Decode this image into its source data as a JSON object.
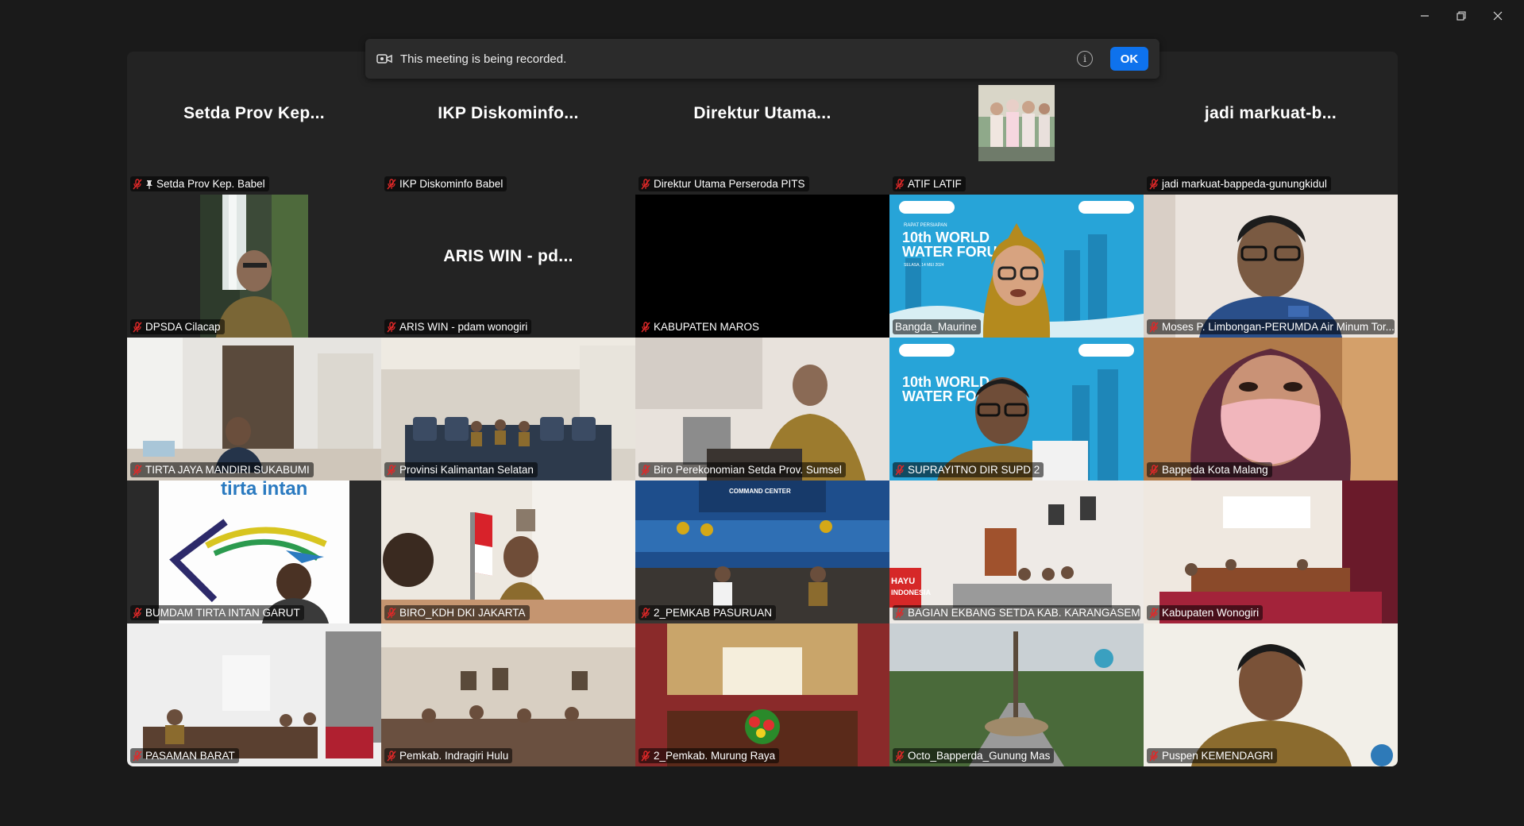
{
  "window": {
    "minimize_icon": "minimize-icon",
    "restore_icon": "restore-icon",
    "close_icon": "close-icon"
  },
  "recording_banner": {
    "text": "This meeting is being recorded.",
    "ok_label": "OK",
    "info_symbol": "i"
  },
  "colors": {
    "background": "#1a1a1a",
    "tile": "#232323",
    "active_speaker": "#3be06f",
    "ok_button": "#0e72ed",
    "mute_red": "#e02828"
  },
  "participants": [
    {
      "big_name": "Setda Prov Kep...",
      "label": "Setda Prov Kep. Babel",
      "pinned": true
    },
    {
      "big_name": "IKP Diskominfo...",
      "label": "IKP Diskominfo Babel"
    },
    {
      "big_name": "Direktur Utama...",
      "label": "Direktur Utama Perseroda PITS"
    },
    {
      "label": "ATIF LATIF"
    },
    {
      "big_name": "jadi markuat-b...",
      "label": "jadi markuat-bappeda-gunungkidul"
    },
    {
      "label": "DPSDA Cilacap"
    },
    {
      "big_name": "ARIS WIN - pd...",
      "label": "ARIS WIN - pdam wonogiri"
    },
    {
      "label": "KABUPATEN MAROS"
    },
    {
      "label": "Bangda_Maurine",
      "video_text": {
        "line1": "RAPAT PERSIAPAN",
        "line2": "10th WORLD",
        "line3": "WATER FORUM",
        "line4": "SELASA, 14 MEI 2024"
      }
    },
    {
      "label": "Moses P. Limbongan-PERUMDA Air Minum Tor..."
    },
    {
      "label": "TIRTA JAYA MANDIRI SUKABUMI"
    },
    {
      "label": "Provinsi Kalimantan Selatan"
    },
    {
      "label": "Biro Perekonomian Setda Prov. Sumsel"
    },
    {
      "label": "SUPRAYITNO DIR SUPD 2",
      "video_text": {
        "line1": "10th WORLD",
        "line2": "WATER FOR"
      }
    },
    {
      "label": "Bappeda Kota Malang"
    },
    {
      "label": "BUMDAM TIRTA INTAN GARUT",
      "video_text": {
        "line1": "tirta intan"
      }
    },
    {
      "label": "BIRO_KDH DKI JAKARTA"
    },
    {
      "label": "2_PEMKAB PASURUAN",
      "video_text": {
        "line1": "COMMAND CENTER"
      }
    },
    {
      "label": "BAGIAN EKBANG SETDA KAB. KARANGASEM",
      "video_text": {
        "line1": "HAYU",
        "line2": "INDONESIA"
      }
    },
    {
      "label": "Kabupaten Wonogiri"
    },
    {
      "label": "PASAMAN BARAT"
    },
    {
      "label": "Pemkab. Indragiri Hulu"
    },
    {
      "label": "2_Pemkab. Murung Raya"
    },
    {
      "label": "Octo_Bapperda_Gunung Mas"
    },
    {
      "label": "Puspen KEMENDAGRI"
    }
  ]
}
